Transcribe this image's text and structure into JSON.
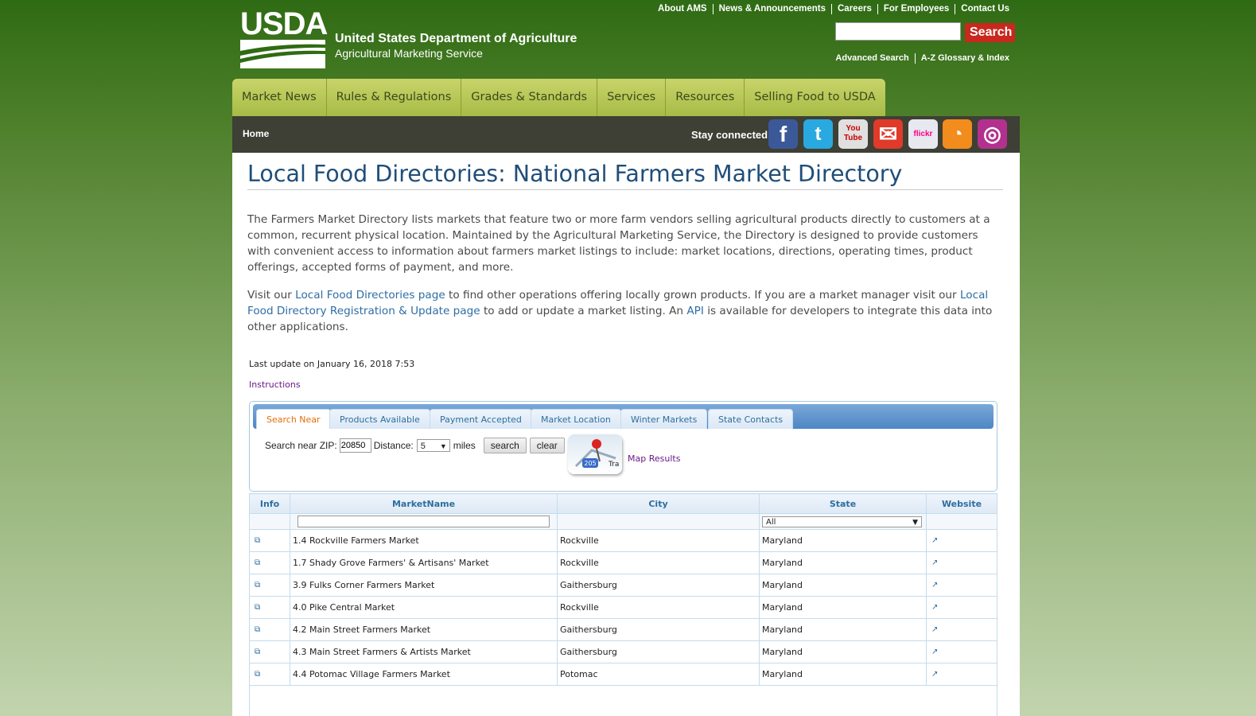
{
  "header": {
    "logo_text": "USDA",
    "agency_title": "United States Department of Agriculture",
    "agency_subtitle": "Agricultural Marketing Service",
    "top_links": [
      "About AMS",
      "News & Announcements",
      "Careers",
      "For Employees",
      "Contact Us"
    ],
    "search_button": "Search",
    "search_value": "",
    "sub_links": [
      "Advanced Search",
      "A-Z Glossary & Index"
    ]
  },
  "nav": {
    "items": [
      "Market News",
      "Rules & Regulations",
      "Grades & Standards",
      "Services",
      "Resources",
      "Selling Food to USDA"
    ]
  },
  "bar": {
    "home": "Home",
    "stay_connected": "Stay connected:",
    "social": [
      {
        "icon": "facebook-icon",
        "glyph": "f",
        "color": "#3b5998"
      },
      {
        "icon": "twitter-icon",
        "glyph": "t",
        "color": "#29a9e0"
      },
      {
        "icon": "youtube-icon",
        "glyph": "You Tube",
        "color": "#e0e0e0"
      },
      {
        "icon": "email-icon",
        "glyph": "✉",
        "color": "#e03a2a"
      },
      {
        "icon": "flickr-icon",
        "glyph": "flickr",
        "color": "#e8e8f0"
      },
      {
        "icon": "rss-icon",
        "glyph": "◔",
        "color": "#f28c1c"
      },
      {
        "icon": "instagram-icon",
        "glyph": "◎",
        "color": "#b3318e"
      }
    ]
  },
  "page": {
    "title": "Local Food Directories: National Farmers Market Directory",
    "intro": "The Farmers Market Directory lists markets that feature two or more farm vendors selling agricultural products directly to customers at a common, recurrent physical location. Maintained by the Agricultural Marketing Service, the Directory is designed to provide customers with convenient access to information about farmers market listings to include: market locations, directions, operating times, product offerings, accepted forms of payment, and more.",
    "visit": {
      "t1": "Visit our ",
      "link1": "Local Food Directories page",
      "t2": " to find other operations offering locally grown products. If you are a market manager visit our ",
      "link2": "Local Food Directory Registration & Update page",
      "t3": " to add or update a market listing. An ",
      "link3": "API",
      "t4": " is available for developers to integrate this data into other applications."
    },
    "last_update": "Last update on January 16, 2018 7:53",
    "instructions": "Instructions"
  },
  "search": {
    "tabs": [
      "Search Near",
      "Products Available",
      "Payment Accepted",
      "Market Location",
      "Winter Markets",
      "State Contacts"
    ],
    "active_tab": "Search Near",
    "zip_label": "Search near ZIP:",
    "zip_value": "20850",
    "distance_label": "Distance:",
    "distance_value": "5",
    "miles": "miles",
    "search_btn": "search",
    "clear_btn": "clear",
    "map_results": "Map Results",
    "map_badge": "205",
    "map_label": "Tra"
  },
  "table": {
    "headers": [
      "Info",
      "MarketName",
      "City",
      "State",
      "Website"
    ],
    "state_filter": "All",
    "rows": [
      {
        "name": "1.4 Rockville Farmers Market",
        "city": "Rockville",
        "state": "Maryland"
      },
      {
        "name": "1.7 Shady Grove Farmers' & Artisans' Market",
        "city": "Rockville",
        "state": "Maryland"
      },
      {
        "name": "3.9 Fulks Corner Farmers Market",
        "city": "Gaithersburg",
        "state": "Maryland"
      },
      {
        "name": "4.0 Pike Central Market",
        "city": "Rockville",
        "state": "Maryland"
      },
      {
        "name": "4.2 Main Street Farmers Market",
        "city": "Gaithersburg",
        "state": "Maryland"
      },
      {
        "name": "4.3 Main Street Farmers & Artists Market",
        "city": "Gaithersburg",
        "state": "Maryland"
      },
      {
        "name": "4.4 Potomac Village Farmers Market",
        "city": "Potomac",
        "state": "Maryland"
      }
    ]
  }
}
